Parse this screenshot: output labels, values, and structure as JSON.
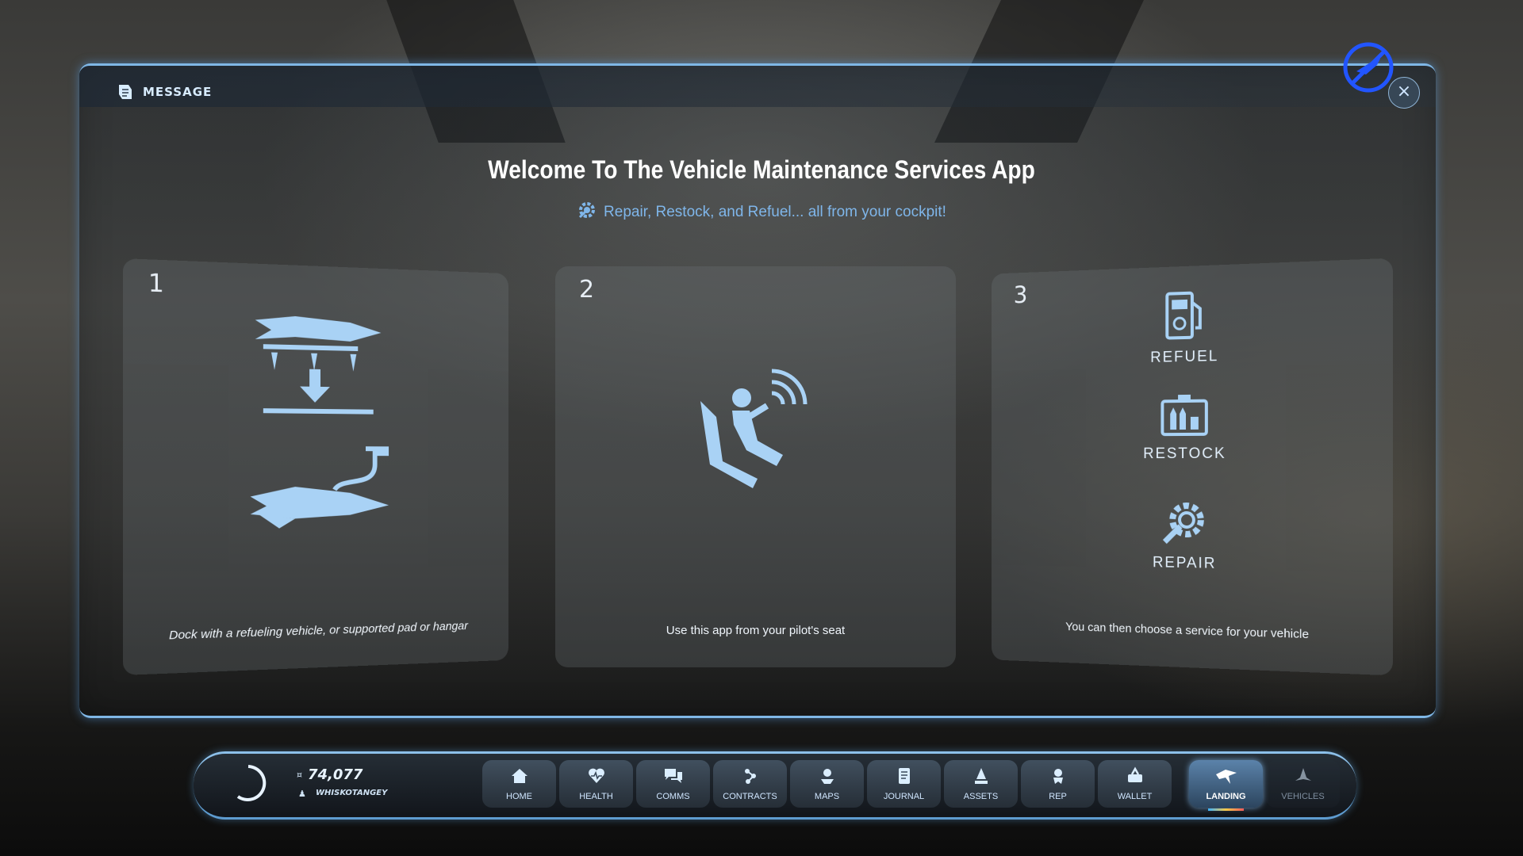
{
  "window": {
    "header_title": "MESSAGE",
    "close_label": "×"
  },
  "main": {
    "title": "Welcome To The Vehicle Maintenance Services App",
    "subtitle": "Repair, Restock, and Refuel... all from your cockpit!",
    "steps": [
      {
        "number": "1",
        "caption": "Dock with a refueling vehicle, or supported pad or hangar"
      },
      {
        "number": "2",
        "caption": "Use this app from your pilot's seat"
      },
      {
        "number": "3",
        "caption": "You can then choose a service for your vehicle",
        "services": [
          "REFUEL",
          "RESTOCK",
          "REPAIR"
        ]
      }
    ]
  },
  "bottom_bar": {
    "credits": "74,077",
    "player_name": "WHISKOTANGEY",
    "nav": [
      {
        "label": "HOME",
        "icon": "home-icon"
      },
      {
        "label": "HEALTH",
        "icon": "health-icon"
      },
      {
        "label": "COMMS",
        "icon": "comms-icon"
      },
      {
        "label": "CONTRACTS",
        "icon": "contracts-icon"
      },
      {
        "label": "MAPS",
        "icon": "maps-icon"
      },
      {
        "label": "JOURNAL",
        "icon": "journal-icon"
      },
      {
        "label": "ASSETS",
        "icon": "assets-icon"
      },
      {
        "label": "REP",
        "icon": "rep-icon"
      },
      {
        "label": "WALLET",
        "icon": "wallet-icon"
      },
      {
        "label": "LANDING",
        "icon": "landing-icon",
        "active": true
      },
      {
        "label": "VEHICLES",
        "icon": "vehicles-icon"
      }
    ]
  }
}
